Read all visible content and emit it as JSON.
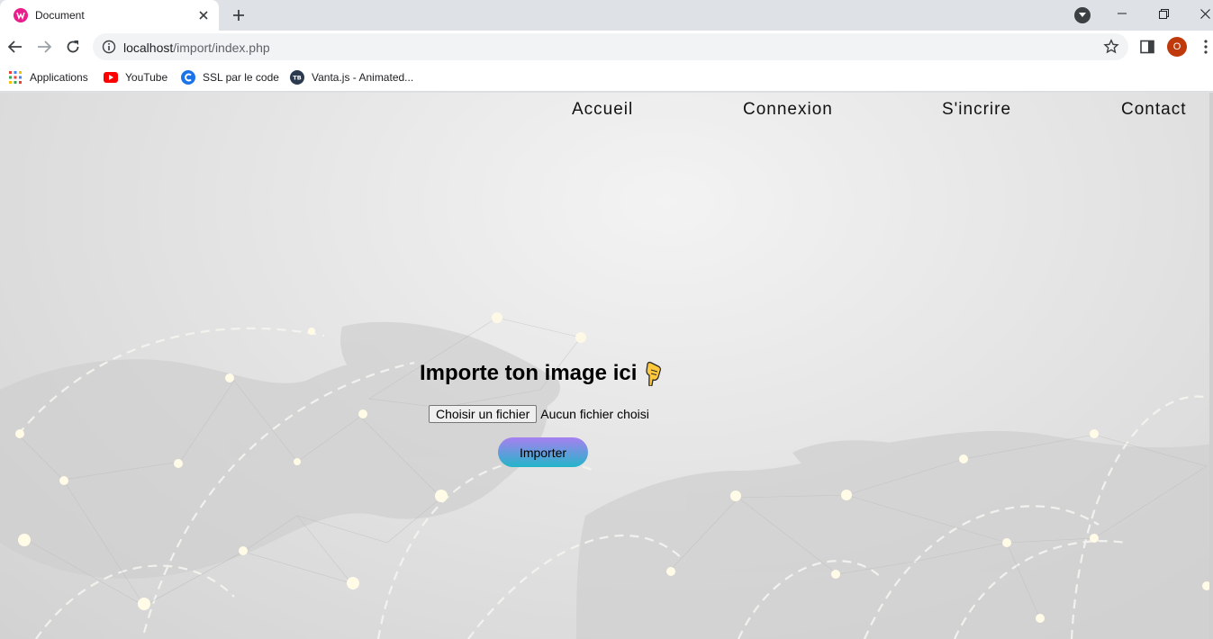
{
  "browser": {
    "tab_title": "Document",
    "url_host": "localhost",
    "url_path": "/import/index.php",
    "avatar_letter": "O",
    "bookmarks": [
      "Applications",
      "YouTube",
      "SSL par le code",
      "Vanta.js - Animated..."
    ]
  },
  "page": {
    "nav": [
      "Accueil",
      "Connexion",
      "S'incrire",
      "Contact"
    ],
    "heading": "Importe ton image ici",
    "file_button": "Choisir un fichier",
    "file_status": "Aucun fichier choisi",
    "submit": "Importer"
  },
  "colors": {
    "favicon": "#e91e8c",
    "avatar": "#c0390b",
    "import_gradient_top": "#a77ff0",
    "import_gradient_bottom": "#23b5c9"
  }
}
